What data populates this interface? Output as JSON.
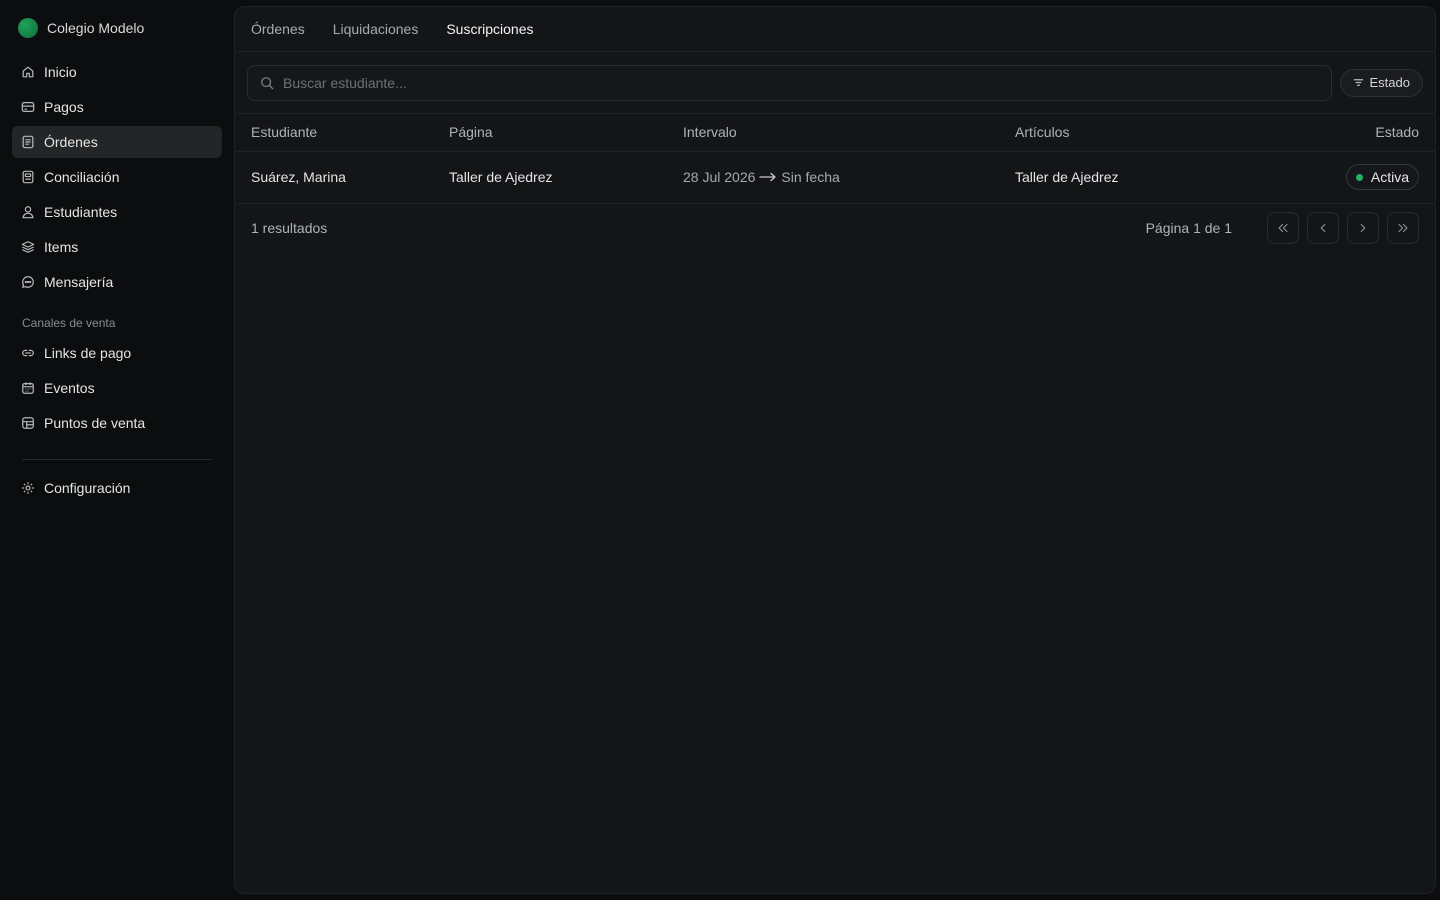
{
  "brand": {
    "name": "Colegio Modelo",
    "color": "#16904a"
  },
  "sidebar": {
    "items": [
      {
        "label": "Inicio",
        "icon": "home-icon"
      },
      {
        "label": "Pagos",
        "icon": "credit-card-icon"
      },
      {
        "label": "Órdenes",
        "icon": "document-icon",
        "active": true
      },
      {
        "label": "Conciliación",
        "icon": "receipt-icon"
      },
      {
        "label": "Estudiantes",
        "icon": "user-icon"
      },
      {
        "label": "Items",
        "icon": "layers-icon"
      },
      {
        "label": "Mensajería",
        "icon": "message-icon"
      }
    ],
    "section_label": "Canales de venta",
    "channels": [
      {
        "label": "Links de pago",
        "icon": "link-icon"
      },
      {
        "label": "Eventos",
        "icon": "calendar-icon"
      },
      {
        "label": "Puntos de venta",
        "icon": "store-icon"
      }
    ],
    "settings": {
      "label": "Configuración",
      "icon": "gear-icon"
    }
  },
  "tabs": [
    {
      "label": "Órdenes",
      "active": false
    },
    {
      "label": "Liquidaciones",
      "active": false
    },
    {
      "label": "Suscripciones",
      "active": true
    }
  ],
  "search": {
    "placeholder": "Buscar estudiante...",
    "value": ""
  },
  "filter": {
    "label": "Estado",
    "icon": "filter-icon"
  },
  "table": {
    "columns": [
      "Estudiante",
      "Página",
      "Intervalo",
      "Artículos",
      "Estado"
    ],
    "rows": [
      {
        "student": "Suárez, Marina",
        "page": "Taller de Ajedrez",
        "interval_start": "28 Jul 2026",
        "interval_end": "Sin fecha",
        "items": "Taller de Ajedrez",
        "status": "Activa",
        "status_color": "#22b35e"
      }
    ]
  },
  "footer": {
    "results": "1 resultados",
    "page_info": "Página 1 de 1"
  }
}
